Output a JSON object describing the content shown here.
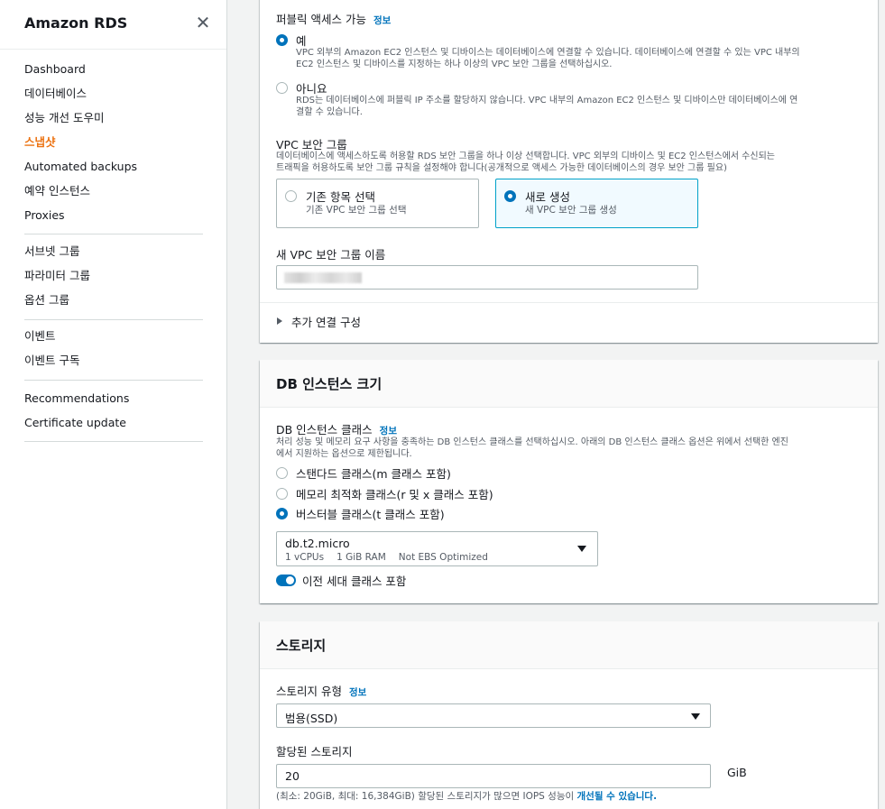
{
  "sidebar": {
    "title": "Amazon RDS",
    "close_icon": "close-icon",
    "groups": [
      [
        "Dashboard",
        "데이터베이스",
        "성능 개선 도우미",
        "스냅샷",
        "Automated backups",
        "예약 인스턴스",
        "Proxies"
      ],
      [
        "서브넷 그룹",
        "파라미터 그룹",
        "옵션 그룹"
      ],
      [
        "이벤트",
        "이벤트 구독"
      ],
      [
        "Recommendations",
        "Certificate update"
      ]
    ],
    "active_item": "스냅샷"
  },
  "connectivity": {
    "public_access": {
      "label": "퍼블릭 액세스 가능",
      "info": "정보",
      "options": [
        {
          "label": "예",
          "desc_line1": "VPC 외부의 Amazon EC2 인스턴스 및 디바이스는 데이터베이스에 연결할 수 있습니다. 데이터베이스에 연결할 수 있는 VPC 내부의",
          "desc_line2": "EC2 인스턴스 및 디바이스를 지정하는 하나 이상의 VPC 보안 그룹을 선택하십시오.",
          "checked": true
        },
        {
          "label": "아니요",
          "desc_line1": "RDS는 데이터베이스에 퍼블릭 IP 주소를 할당하지 않습니다. VPC 내부의 Amazon EC2 인스턴스 및 디바이스만 데이터베이스에 연",
          "desc_line2": "결할 수 있습니다.",
          "checked": false
        }
      ]
    },
    "vpc_sg": {
      "label": "VPC 보안 그룹",
      "desc_line1": "데이터베이스에 액세스하도록 허용할 RDS 보안 그룹을 하나 이상 선택합니다. VPC 외부의 디바이스 및 EC2 인스턴스에서 수신되는",
      "desc_line2": "트래픽을 허용하도록 보안 그룹 규칙을 설정해야 합니다(공개적으로 액세스 가능한 데이터베이스의 경우 보안 그룹 필요)",
      "tiles": [
        {
          "title": "기존 항목 선택",
          "desc": "기존 VPC 보안 그룹 선택",
          "selected": false
        },
        {
          "title": "새로 생성",
          "desc": "새 VPC 보안 그룹 생성",
          "selected": true
        }
      ]
    },
    "new_sg_name": {
      "label": "새 VPC 보안 그룹 이름",
      "value": ""
    },
    "additional": {
      "label": "추가 연결 구성"
    }
  },
  "instance_size": {
    "title": "DB 인스턴스 크기",
    "class_label": "DB 인스턴스 클래스",
    "info": "정보",
    "desc_line1": "처리 성능 및 메모리 요구 사항을 충족하는 DB 인스턴스 클래스를 선택하십시오. 아래의 DB 인스턴스 클래스 옵션은 위에서 선택한 엔진",
    "desc_line2": "에서 지원하는 옵션으로 제한됩니다.",
    "options": [
      {
        "label": "스탠다드 클래스(m 클래스 포함)",
        "checked": false
      },
      {
        "label": "메모리 최적화 클래스(r 및 x 클래스 포함)",
        "checked": false
      },
      {
        "label": "버스터블 클래스(t 클래스 포함)",
        "checked": true
      }
    ],
    "selected_class": {
      "name": "db.t2.micro",
      "vcpus": "1 vCPUs",
      "ram": "1 GiB RAM",
      "ebs": "Not EBS Optimized"
    },
    "toggle": {
      "label": "이전 세대 클래스 포함",
      "on": true
    }
  },
  "storage": {
    "title": "스토리지",
    "type_label": "스토리지 유형",
    "info": "정보",
    "type_value": "범용(SSD)",
    "allocated_label": "할당된 스토리지",
    "allocated_value": "20",
    "unit": "GiB",
    "hint_prefix": "(최소: 20GiB, 최대: 16,384GiB) 할당된 스토리지가 많으면 IOPS 성능이 ",
    "hint_link": "개선될 수 있습니다."
  }
}
